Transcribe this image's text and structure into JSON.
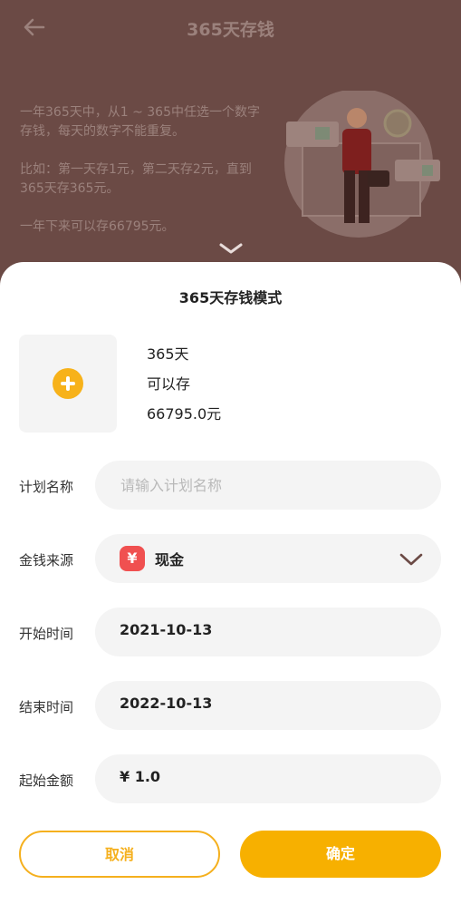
{
  "header": {
    "title": "365天存钱"
  },
  "intro": {
    "p1": "一年365天中，从1 ~ 365中任选一个数字存钱，每天的数字不能重复。",
    "p2": "比如：第一天存1元，第二天存2元，直到365天存365元。",
    "p3": "一年下来可以存66795元。"
  },
  "sheet": {
    "title": "365天存钱模式",
    "summary": {
      "line1": "365天",
      "line2": "可以存",
      "line3": "66795.0元"
    },
    "fields": {
      "plan_name": {
        "label": "计划名称",
        "placeholder": "请输入计划名称",
        "value": ""
      },
      "money_source": {
        "label": "金钱来源",
        "icon_text": "¥",
        "value": "现金"
      },
      "start_time": {
        "label": "开始时间",
        "value": "2021-10-13"
      },
      "end_time": {
        "label": "结束时间",
        "value": "2022-10-13"
      },
      "start_amount": {
        "label": "起始金额",
        "value": "¥ 1.0"
      }
    },
    "buttons": {
      "cancel": "取消",
      "confirm": "确定"
    }
  },
  "colors": {
    "accent": "#f7b000",
    "overlay": "#6b4a45",
    "badge": "#f05050"
  }
}
